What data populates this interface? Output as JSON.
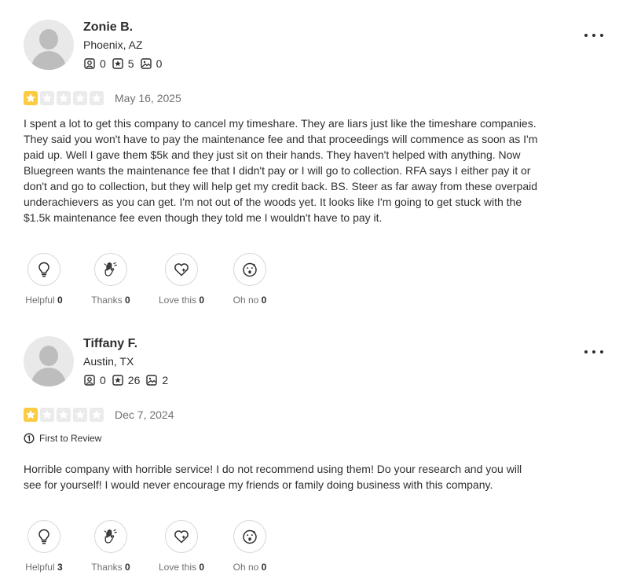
{
  "colors": {
    "star_filled": "#fbcb42",
    "star_empty": "#ebebeb",
    "text_primary": "#2d2e2f",
    "text_secondary": "#6e7072",
    "border": "#d6d7d9"
  },
  "reviews": [
    {
      "user": {
        "name": "Zonie B.",
        "location": "Phoenix, AZ",
        "friends": "0",
        "reviews": "5",
        "photos": "0"
      },
      "rating": 1,
      "date": "May 16, 2025",
      "text": "I spent a lot to get this company to cancel my timeshare. They are liars just like the timeshare companies. They said you won't have to pay the maintenance fee and that proceedings will commence as soon as I'm paid up. Well I gave them $5k and they just sit on their hands. They haven't helped with anything. Now Bluegreen wants the maintenance fee that I didn't pay or I will go to collection. RFA says I either pay it or don't and go to collection, but they will help get my credit back. BS. Steer as far away from these overpaid underachievers as you can get. I'm not out of the woods yet. It looks like I'm going to get stuck with the $1.5k maintenance fee even though they told me I wouldn't have to pay it.",
      "reactions": {
        "helpful_label": "Helpful",
        "helpful_count": "0",
        "thanks_label": "Thanks",
        "thanks_count": "0",
        "love_label": "Love this",
        "love_count": "0",
        "ohno_label": "Oh no",
        "ohno_count": "0"
      }
    },
    {
      "user": {
        "name": "Tiffany F.",
        "location": "Austin, TX",
        "friends": "0",
        "reviews": "26",
        "photos": "2"
      },
      "rating": 1,
      "date": "Dec 7, 2024",
      "badge": "First to Review",
      "text": "Horrible company with horrible service! I do not recommend using them! Do your research and you will see for yourself! I would never encourage my friends or family doing business with this company.",
      "reactions": {
        "helpful_label": "Helpful",
        "helpful_count": "3",
        "thanks_label": "Thanks",
        "thanks_count": "0",
        "love_label": "Love this",
        "love_count": "0",
        "ohno_label": "Oh no",
        "ohno_count": "0"
      }
    }
  ]
}
